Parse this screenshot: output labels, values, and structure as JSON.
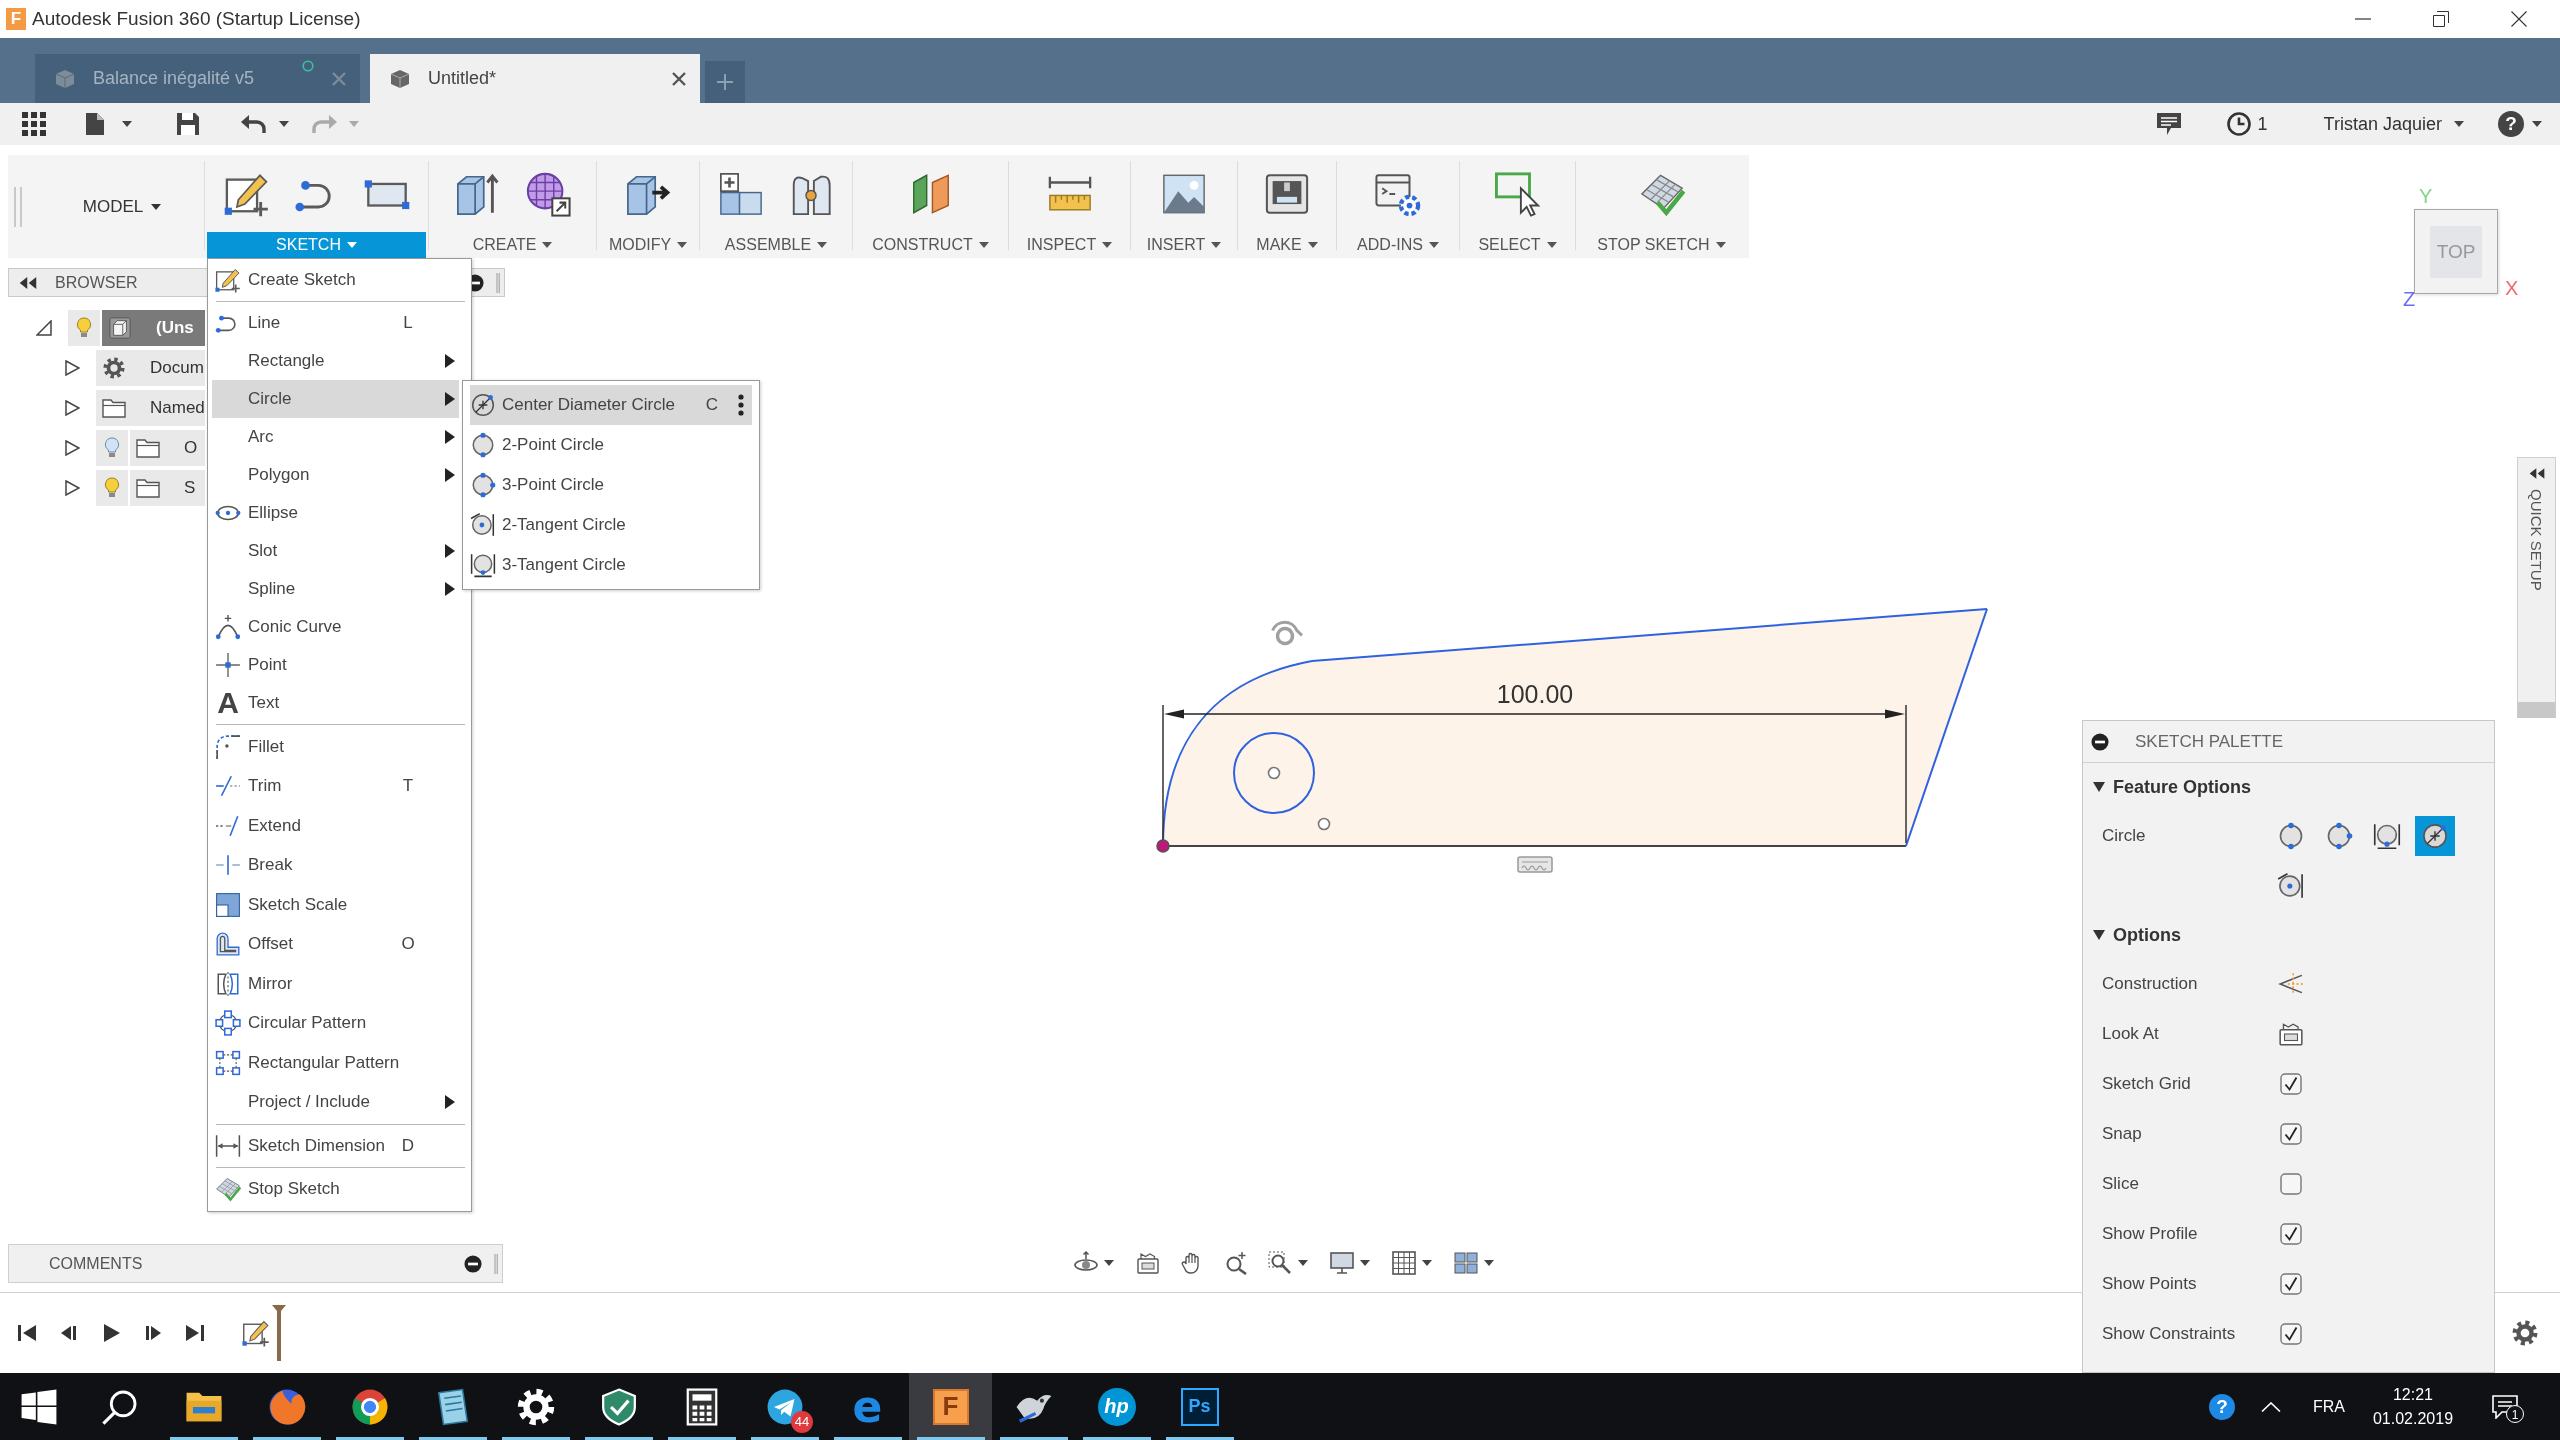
{
  "window": {
    "logo": "F",
    "title": "Autodesk Fusion 360 (Startup License)"
  },
  "tabs": [
    {
      "label": "Balance inégalité v5",
      "selected": false,
      "synced": true
    },
    {
      "label": "Untitled*",
      "selected": true,
      "synced": false
    }
  ],
  "quick_access": {
    "undo": {
      "disabled": false
    },
    "redo": {
      "disabled": true
    },
    "jobs": "1",
    "user": "Tristan Jaquier",
    "help": "?"
  },
  "toolbar": {
    "workspace": "MODEL",
    "groups": [
      {
        "label": "SKETCH",
        "expanded": true
      },
      {
        "label": "CREATE",
        "expanded": false
      },
      {
        "label": "MODIFY",
        "expanded": false
      },
      {
        "label": "ASSEMBLE",
        "expanded": false
      },
      {
        "label": "CONSTRUCT",
        "expanded": false
      },
      {
        "label": "INSPECT",
        "expanded": false
      },
      {
        "label": "INSERT",
        "expanded": false
      },
      {
        "label": "MAKE",
        "expanded": false
      },
      {
        "label": "ADD-INS",
        "expanded": false
      },
      {
        "label": "SELECT",
        "expanded": false
      },
      {
        "label": "STOP SKETCH",
        "expanded": false
      }
    ]
  },
  "browser": {
    "title": "BROWSER",
    "tree": [
      {
        "label": "(Uns",
        "kind": "component",
        "visible": true,
        "expanded": true,
        "selected": true,
        "children": [
          {
            "label": "Docum",
            "kind": "settings",
            "expanded": false,
            "selected": false
          },
          {
            "label": "Named",
            "kind": "folder",
            "expanded": false,
            "selected": false
          },
          {
            "label": "O",
            "kind": "folder",
            "visible": false,
            "expanded": false,
            "selected": false
          },
          {
            "label": "S",
            "kind": "folder",
            "visible": true,
            "expanded": false,
            "selected": false
          }
        ]
      }
    ]
  },
  "sketch_menu": {
    "groups": [
      [
        {
          "label": "Create Sketch",
          "submenu": false,
          "selected": false
        }
      ],
      [
        {
          "label": "Line",
          "shortcut": "L",
          "submenu": false,
          "selected": false
        },
        {
          "label": "Rectangle",
          "submenu": true,
          "selected": false
        },
        {
          "label": "Circle",
          "submenu": true,
          "selected": true
        },
        {
          "label": "Arc",
          "submenu": true,
          "selected": false
        },
        {
          "label": "Polygon",
          "submenu": true,
          "selected": false
        },
        {
          "label": "Ellipse",
          "submenu": false,
          "selected": false
        },
        {
          "label": "Slot",
          "submenu": true,
          "selected": false
        },
        {
          "label": "Spline",
          "submenu": true,
          "selected": false
        },
        {
          "label": "Conic Curve",
          "submenu": false,
          "selected": false
        },
        {
          "label": "Point",
          "submenu": false,
          "selected": false
        },
        {
          "label": "Text",
          "glyph": "A",
          "submenu": false,
          "selected": false
        }
      ],
      [
        {
          "label": "Fillet",
          "submenu": false,
          "selected": false
        },
        {
          "label": "Trim",
          "shortcut": "T",
          "submenu": false,
          "selected": false
        },
        {
          "label": "Extend",
          "submenu": false,
          "selected": false
        },
        {
          "label": "Break",
          "submenu": false,
          "selected": false
        },
        {
          "label": "Sketch Scale",
          "submenu": false,
          "selected": false
        },
        {
          "label": "Offset",
          "shortcut": "O",
          "submenu": false,
          "selected": false
        },
        {
          "label": "Mirror",
          "submenu": false,
          "selected": false
        },
        {
          "label": "Circular Pattern",
          "submenu": false,
          "selected": false
        },
        {
          "label": "Rectangular Pattern",
          "submenu": false,
          "selected": false
        },
        {
          "label": "Project / Include",
          "submenu": true,
          "selected": false
        }
      ],
      [
        {
          "label": "Sketch Dimension",
          "shortcut": "D",
          "submenu": false,
          "selected": false
        }
      ],
      [
        {
          "label": "Stop Sketch",
          "submenu": false,
          "selected": false
        }
      ]
    ],
    "submenu": [
      {
        "label": "Center Diameter Circle",
        "shortcut": "C",
        "selected": true
      },
      {
        "label": "2-Point Circle",
        "selected": false
      },
      {
        "label": "3-Point Circle",
        "selected": false
      },
      {
        "label": "2-Tangent Circle",
        "selected": false
      },
      {
        "label": "3-Tangent Circle",
        "selected": false
      }
    ]
  },
  "view_cube": {
    "face": "TOP",
    "axes": [
      {
        "label": "Y",
        "color": "#7fd67f"
      },
      {
        "label": "X",
        "color": "#f06a6a"
      },
      {
        "label": "Z",
        "color": "#6b6ef0"
      }
    ]
  },
  "quick_setup": {
    "title": "QUICK SETUP"
  },
  "sketch": {
    "dimension": "100.00"
  },
  "sketch_palette": {
    "title": "SKETCH PALETTE",
    "sections": [
      {
        "title": "Feature Options",
        "expanded": true,
        "rows": [
          {
            "kind": "icon_choice",
            "label": "Circle",
            "options": [
              {
                "selected": false
              },
              {
                "selected": false
              },
              {
                "selected": false
              },
              {
                "selected": true
              },
              {
                "selected": false
              }
            ]
          }
        ]
      },
      {
        "title": "Options",
        "expanded": true,
        "rows": [
          {
            "kind": "button",
            "label": "Construction"
          },
          {
            "kind": "button",
            "label": "Look At"
          },
          {
            "kind": "checkbox",
            "label": "Sketch Grid",
            "checked": true
          },
          {
            "kind": "checkbox",
            "label": "Snap",
            "checked": true
          },
          {
            "kind": "checkbox",
            "label": "Slice",
            "checked": false
          },
          {
            "kind": "checkbox",
            "label": "Show Profile",
            "checked": true
          },
          {
            "kind": "checkbox",
            "label": "Show Points",
            "checked": true
          },
          {
            "kind": "checkbox",
            "label": "Show Constraints",
            "checked": true
          }
        ]
      }
    ]
  },
  "comments": {
    "title": "COMMENTS"
  },
  "taskbar": {
    "apps": [
      {
        "running": true,
        "selected": false
      },
      {
        "running": true,
        "selected": false
      },
      {
        "running": true,
        "selected": false
      },
      {
        "running": true,
        "selected": false
      },
      {
        "running": true,
        "selected": false
      },
      {
        "running": true,
        "selected": false
      },
      {
        "running": true,
        "selected": false
      },
      {
        "running": true,
        "selected": false,
        "badge": "44"
      },
      {
        "glyph": "e",
        "running": true,
        "selected": false
      },
      {
        "glyph": "F",
        "running": true,
        "selected": true
      },
      {
        "running": true,
        "selected": false
      },
      {
        "glyph": "hp",
        "running": true,
        "selected": false
      },
      {
        "glyph": "Ps",
        "running": true,
        "selected": false
      }
    ],
    "tray": {
      "help": "?",
      "language": "FRA",
      "time": "12:21",
      "date": "01.02.2019",
      "notifications": "1"
    }
  }
}
